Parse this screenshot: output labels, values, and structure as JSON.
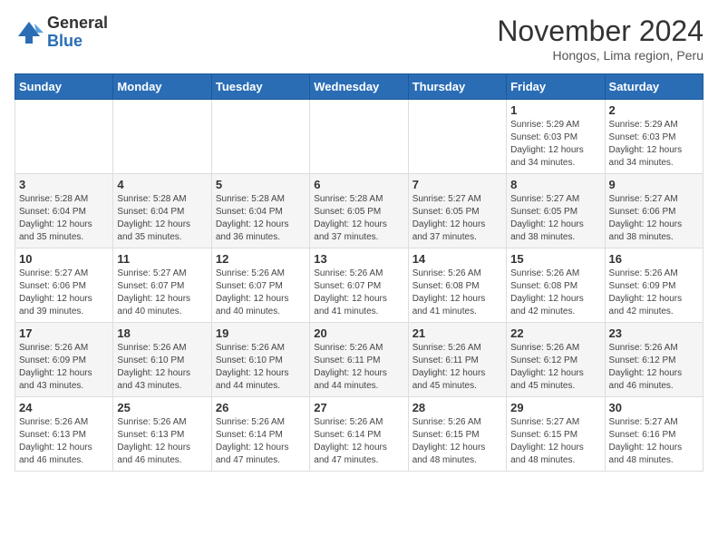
{
  "logo": {
    "general": "General",
    "blue": "Blue"
  },
  "title": "November 2024",
  "location": "Hongos, Lima region, Peru",
  "days_header": [
    "Sunday",
    "Monday",
    "Tuesday",
    "Wednesday",
    "Thursday",
    "Friday",
    "Saturday"
  ],
  "weeks": [
    [
      {
        "day": "",
        "info": ""
      },
      {
        "day": "",
        "info": ""
      },
      {
        "day": "",
        "info": ""
      },
      {
        "day": "",
        "info": ""
      },
      {
        "day": "",
        "info": ""
      },
      {
        "day": "1",
        "info": "Sunrise: 5:29 AM\nSunset: 6:03 PM\nDaylight: 12 hours and 34 minutes."
      },
      {
        "day": "2",
        "info": "Sunrise: 5:29 AM\nSunset: 6:03 PM\nDaylight: 12 hours and 34 minutes."
      }
    ],
    [
      {
        "day": "3",
        "info": "Sunrise: 5:28 AM\nSunset: 6:04 PM\nDaylight: 12 hours and 35 minutes."
      },
      {
        "day": "4",
        "info": "Sunrise: 5:28 AM\nSunset: 6:04 PM\nDaylight: 12 hours and 35 minutes."
      },
      {
        "day": "5",
        "info": "Sunrise: 5:28 AM\nSunset: 6:04 PM\nDaylight: 12 hours and 36 minutes."
      },
      {
        "day": "6",
        "info": "Sunrise: 5:28 AM\nSunset: 6:05 PM\nDaylight: 12 hours and 37 minutes."
      },
      {
        "day": "7",
        "info": "Sunrise: 5:27 AM\nSunset: 6:05 PM\nDaylight: 12 hours and 37 minutes."
      },
      {
        "day": "8",
        "info": "Sunrise: 5:27 AM\nSunset: 6:05 PM\nDaylight: 12 hours and 38 minutes."
      },
      {
        "day": "9",
        "info": "Sunrise: 5:27 AM\nSunset: 6:06 PM\nDaylight: 12 hours and 38 minutes."
      }
    ],
    [
      {
        "day": "10",
        "info": "Sunrise: 5:27 AM\nSunset: 6:06 PM\nDaylight: 12 hours and 39 minutes."
      },
      {
        "day": "11",
        "info": "Sunrise: 5:27 AM\nSunset: 6:07 PM\nDaylight: 12 hours and 40 minutes."
      },
      {
        "day": "12",
        "info": "Sunrise: 5:26 AM\nSunset: 6:07 PM\nDaylight: 12 hours and 40 minutes."
      },
      {
        "day": "13",
        "info": "Sunrise: 5:26 AM\nSunset: 6:07 PM\nDaylight: 12 hours and 41 minutes."
      },
      {
        "day": "14",
        "info": "Sunrise: 5:26 AM\nSunset: 6:08 PM\nDaylight: 12 hours and 41 minutes."
      },
      {
        "day": "15",
        "info": "Sunrise: 5:26 AM\nSunset: 6:08 PM\nDaylight: 12 hours and 42 minutes."
      },
      {
        "day": "16",
        "info": "Sunrise: 5:26 AM\nSunset: 6:09 PM\nDaylight: 12 hours and 42 minutes."
      }
    ],
    [
      {
        "day": "17",
        "info": "Sunrise: 5:26 AM\nSunset: 6:09 PM\nDaylight: 12 hours and 43 minutes."
      },
      {
        "day": "18",
        "info": "Sunrise: 5:26 AM\nSunset: 6:10 PM\nDaylight: 12 hours and 43 minutes."
      },
      {
        "day": "19",
        "info": "Sunrise: 5:26 AM\nSunset: 6:10 PM\nDaylight: 12 hours and 44 minutes."
      },
      {
        "day": "20",
        "info": "Sunrise: 5:26 AM\nSunset: 6:11 PM\nDaylight: 12 hours and 44 minutes."
      },
      {
        "day": "21",
        "info": "Sunrise: 5:26 AM\nSunset: 6:11 PM\nDaylight: 12 hours and 45 minutes."
      },
      {
        "day": "22",
        "info": "Sunrise: 5:26 AM\nSunset: 6:12 PM\nDaylight: 12 hours and 45 minutes."
      },
      {
        "day": "23",
        "info": "Sunrise: 5:26 AM\nSunset: 6:12 PM\nDaylight: 12 hours and 46 minutes."
      }
    ],
    [
      {
        "day": "24",
        "info": "Sunrise: 5:26 AM\nSunset: 6:13 PM\nDaylight: 12 hours and 46 minutes."
      },
      {
        "day": "25",
        "info": "Sunrise: 5:26 AM\nSunset: 6:13 PM\nDaylight: 12 hours and 46 minutes."
      },
      {
        "day": "26",
        "info": "Sunrise: 5:26 AM\nSunset: 6:14 PM\nDaylight: 12 hours and 47 minutes."
      },
      {
        "day": "27",
        "info": "Sunrise: 5:26 AM\nSunset: 6:14 PM\nDaylight: 12 hours and 47 minutes."
      },
      {
        "day": "28",
        "info": "Sunrise: 5:26 AM\nSunset: 6:15 PM\nDaylight: 12 hours and 48 minutes."
      },
      {
        "day": "29",
        "info": "Sunrise: 5:27 AM\nSunset: 6:15 PM\nDaylight: 12 hours and 48 minutes."
      },
      {
        "day": "30",
        "info": "Sunrise: 5:27 AM\nSunset: 6:16 PM\nDaylight: 12 hours and 48 minutes."
      }
    ]
  ]
}
